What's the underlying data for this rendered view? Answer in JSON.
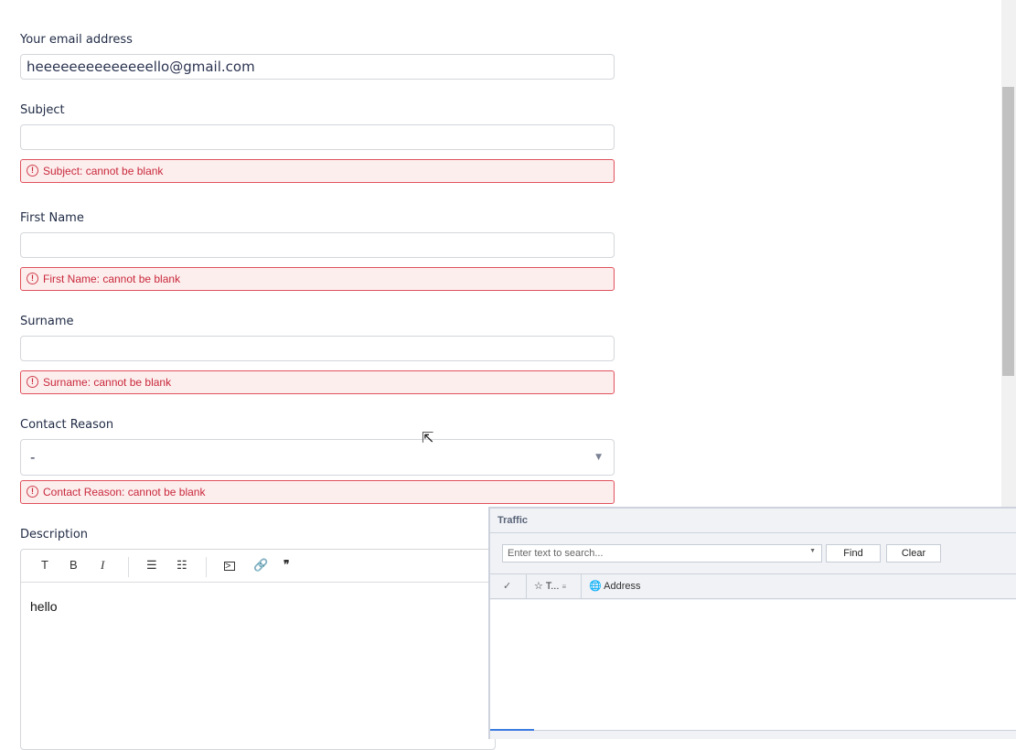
{
  "form": {
    "email": {
      "label": "Your email address",
      "value": "heeeeeeeeeeeeeello@gmail.com"
    },
    "subject": {
      "label": "Subject",
      "value": "",
      "error": "Subject: cannot be blank"
    },
    "first_name": {
      "label": "First Name",
      "value": "",
      "error": "First Name: cannot be blank"
    },
    "surname": {
      "label": "Surname",
      "value": "",
      "error": "Surname: cannot be blank"
    },
    "contact_reason": {
      "label": "Contact Reason",
      "value": "-",
      "error": "Contact Reason: cannot be blank"
    },
    "description": {
      "label": "Description",
      "value": "hello",
      "toolbar": [
        "T",
        "B",
        "I"
      ]
    }
  },
  "error_icon": "!",
  "traffic": {
    "title": "Traffic",
    "search_placeholder": "Enter text to search...",
    "find": "Find",
    "clear": "Clear",
    "columns": {
      "check": "✓",
      "type": "T...",
      "address": "Address"
    }
  }
}
